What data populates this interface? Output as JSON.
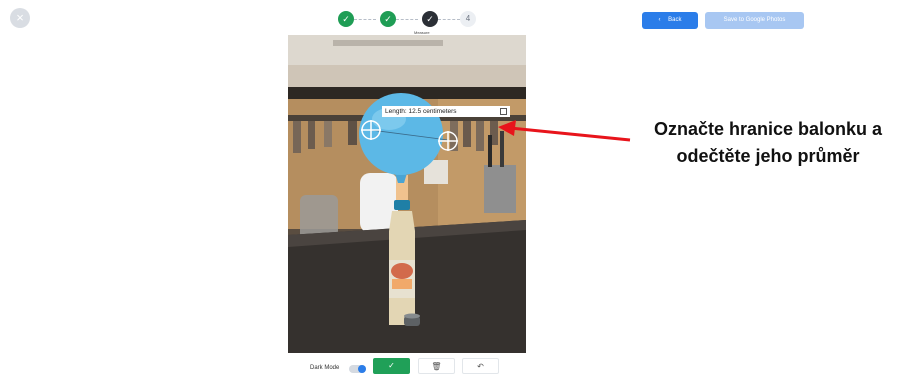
{
  "window": {
    "close_glyph": "×"
  },
  "stepper": {
    "steps": [
      {
        "state": "done",
        "glyph": "✓"
      },
      {
        "state": "done",
        "glyph": "✓"
      },
      {
        "state": "current",
        "glyph": "✓",
        "label": "Measure"
      },
      {
        "state": "todo",
        "glyph": "4"
      }
    ]
  },
  "header": {
    "back_label": "Back",
    "back_icon": "chevron-left",
    "save_label": "Save to Google Photos"
  },
  "measurement": {
    "label": "Length: 12.5 centimeters",
    "edit_icon": "edit-icon"
  },
  "bottom_toolbar": {
    "dark_mode_label": "Dark Mode",
    "dark_mode_on": false,
    "confirm_glyph": "✓",
    "delete_glyph": "🗑",
    "undo_glyph": "↶"
  },
  "annotation": {
    "line1": "Označte hranice balonku a",
    "line2": "odečtěte jeho průměr",
    "arrow_color": "#e8141b"
  },
  "colors": {
    "accent": "#2b7de9",
    "success": "#1f9d55",
    "balloon": "#5cb8e6"
  }
}
